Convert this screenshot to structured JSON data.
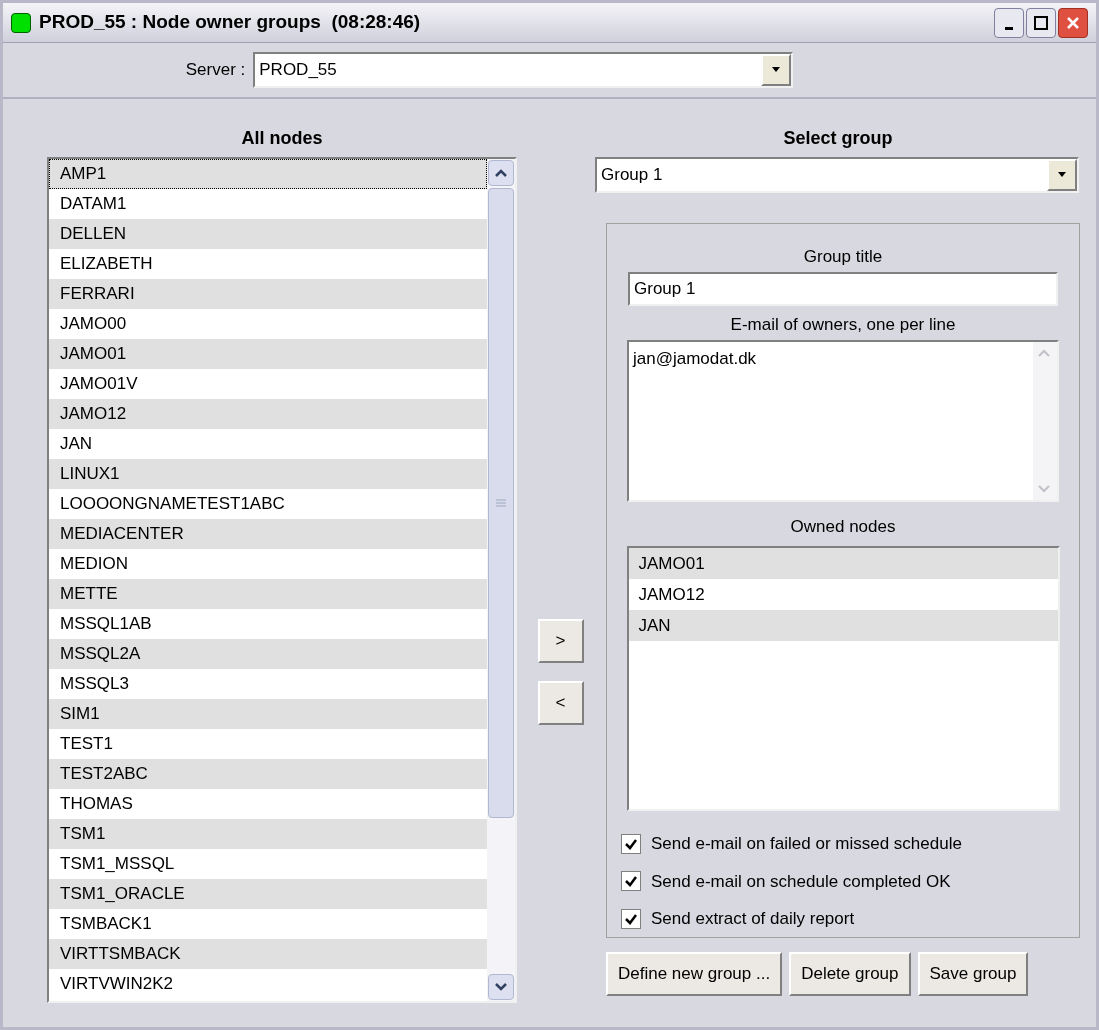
{
  "window": {
    "title": "PROD_55 : Node owner groups  (08:28:46)"
  },
  "server": {
    "label": "Server :",
    "value": "PROD_55"
  },
  "all_nodes": {
    "heading": "All nodes",
    "items": [
      {
        "label": "AMP1",
        "focused": true
      },
      {
        "label": "DATAM1",
        "focused": false
      },
      {
        "label": "DELLEN",
        "focused": false
      },
      {
        "label": "ELIZABETH",
        "focused": false
      },
      {
        "label": "FERRARI",
        "focused": false
      },
      {
        "label": "JAMO00",
        "focused": false
      },
      {
        "label": "JAMO01",
        "focused": false
      },
      {
        "label": "JAMO01V",
        "focused": false
      },
      {
        "label": "JAMO12",
        "focused": false
      },
      {
        "label": "JAN",
        "focused": false
      },
      {
        "label": "LINUX1",
        "focused": false
      },
      {
        "label": "LOOOONGNAMETEST1ABC",
        "focused": false
      },
      {
        "label": "MEDIACENTER",
        "focused": false
      },
      {
        "label": "MEDION",
        "focused": false
      },
      {
        "label": "METTE",
        "focused": false
      },
      {
        "label": "MSSQL1AB",
        "focused": false
      },
      {
        "label": "MSSQL2A",
        "focused": false
      },
      {
        "label": "MSSQL3",
        "focused": false
      },
      {
        "label": "SIM1",
        "focused": false
      },
      {
        "label": "TEST1",
        "focused": false
      },
      {
        "label": "TEST2ABC",
        "focused": false
      },
      {
        "label": "THOMAS",
        "focused": false
      },
      {
        "label": "TSM1",
        "focused": false
      },
      {
        "label": "TSM1_MSSQL",
        "focused": false
      },
      {
        "label": "TSM1_ORACLE",
        "focused": false
      },
      {
        "label": "TSMBACK1",
        "focused": false
      },
      {
        "label": "VIRTTSMBACK",
        "focused": false
      },
      {
        "label": "VIRTVWIN2K2",
        "focused": false
      }
    ]
  },
  "move_buttons": [
    ">",
    "<"
  ],
  "select_group": {
    "heading": "Select group",
    "value": "Group 1"
  },
  "group_details": {
    "title_label": "Group title",
    "title_value": "Group 1",
    "email_label": "E-mail of owners, one per line",
    "email_value": "jan@jamodat.dk",
    "owned_label": "Owned nodes",
    "owned_nodes": [
      "JAMO01",
      "JAMO12",
      "JAN"
    ],
    "options": [
      {
        "label": "Send e-mail on failed or missed schedule",
        "checked": true
      },
      {
        "label": "Send e-mail on schedule completed OK",
        "checked": true
      },
      {
        "label": "Send extract of daily report",
        "checked": true
      }
    ]
  },
  "buttons": [
    "Define new group ...",
    "Delete group",
    "Save group"
  ]
}
